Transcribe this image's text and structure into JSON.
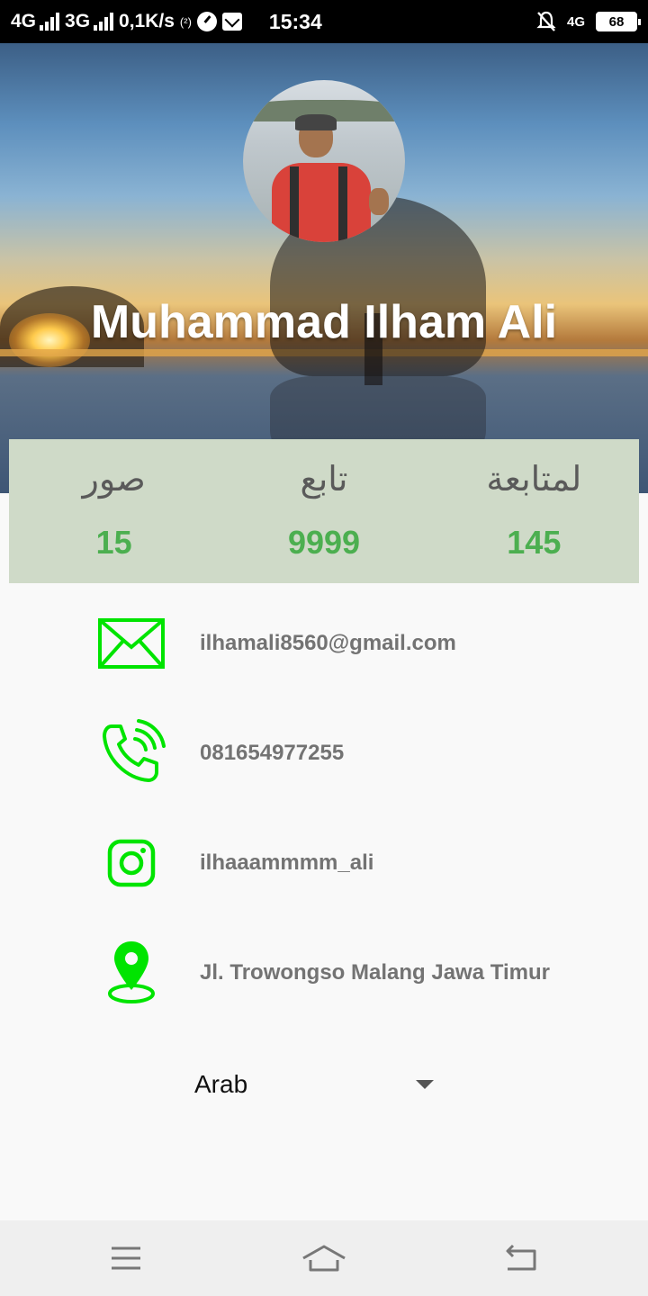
{
  "status_bar": {
    "net1": "4G",
    "net2": "3G",
    "speed": "0,1K/s",
    "hotspot": "(²)",
    "time": "15:34",
    "lte": "4G",
    "battery": "68"
  },
  "profile": {
    "name": "Muhammad Ilham Ali"
  },
  "stats": [
    {
      "label": "صور",
      "value": "15"
    },
    {
      "label": "تابع",
      "value": "9999"
    },
    {
      "label": "لمتابعة",
      "value": "145"
    }
  ],
  "contact": {
    "email": "ilhamali8560@gmail.com",
    "phone": "081654977255",
    "instagram": "ilhaaammmm_ali",
    "address": "Jl. Trowongso Malang Jawa Timur"
  },
  "language_select": {
    "selected": "Arab"
  },
  "colors": {
    "icon_green": "#00e400",
    "stat_value": "#4caf50",
    "stats_bg": "#cfdac8"
  }
}
